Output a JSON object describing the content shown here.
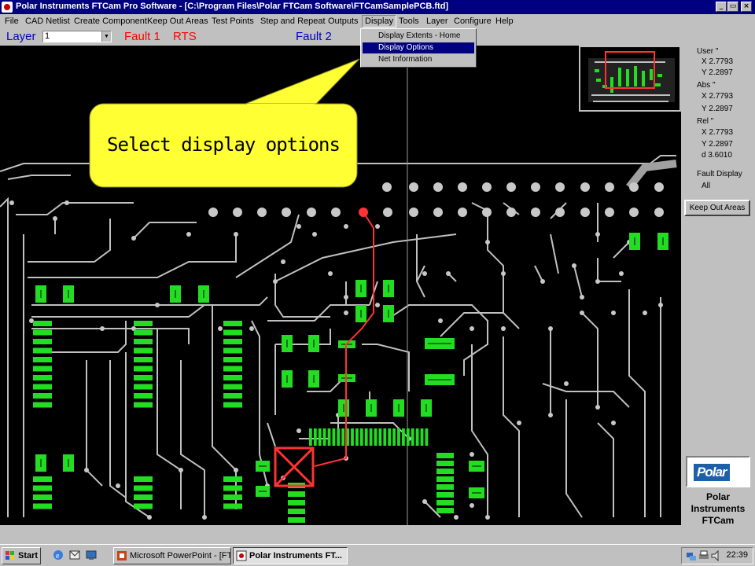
{
  "window": {
    "title": "Polar Instruments FTCam Pro Software - [C:\\Program Files\\Polar FTCam Software\\FTCamSamplePCB.ftd]",
    "controls": [
      "_",
      "▭",
      "×"
    ]
  },
  "menu": [
    "File",
    "CAD Netlist",
    "Create Component",
    "Keep Out Areas",
    "Test Points",
    "Step and Repeat",
    "Outputs",
    "Display",
    "Tools",
    "Layer",
    "Configure",
    "Help"
  ],
  "toolbar": {
    "layer_label": "Layer",
    "layer_value": "1",
    "fault1_label": "Fault 1",
    "rts_label": "RTS",
    "fault2_label": "Fault 2",
    "label_color": "#0000c0",
    "fault_color": "#ff0000"
  },
  "display_menu": {
    "items": [
      "Display Extents - Home",
      "Display Options",
      "Net Information"
    ],
    "highlighted": "Display Options"
  },
  "callout": {
    "text": "Select display options",
    "fill": "#ffff33"
  },
  "coords": {
    "user_label": "User \"",
    "user_x": "X 2.7793",
    "user_y": "Y 2.2897",
    "abs_label": "Abs \"",
    "abs_x": "X 2.7793",
    "abs_y": "Y 2.2897",
    "rel_label": "Rel \"",
    "rel_x": "X 2.7793",
    "rel_y": "Y 2.2897",
    "rel_d": "d 3.6010",
    "fault_display_label": "Fault Display",
    "fault_display_value": "All"
  },
  "keepout_button": "Keep Out Areas",
  "brand": {
    "logo": "Polar",
    "line1": "Polar",
    "line2": "Instruments",
    "line3": "FTCam"
  },
  "taskbar": {
    "start": "Start",
    "tasks": [
      "Microsoft PowerPoint - [FT...",
      "Polar Instruments FT..."
    ],
    "clock": "22:39"
  },
  "colors": {
    "pad_green": "#22dd22",
    "trace_gray": "#c0c0c0",
    "highlight_red": "#ff3333",
    "pcb_background": "#000000"
  }
}
